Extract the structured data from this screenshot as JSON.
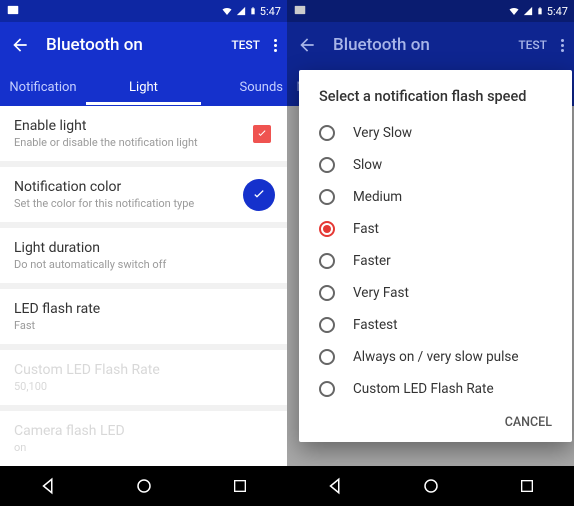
{
  "statusbar": {
    "time": "5:47"
  },
  "appbar": {
    "title": "Bluetooth on",
    "test": "TEST"
  },
  "tabs": {
    "t1": "Notification",
    "t2": "Light",
    "t3": "Sounds"
  },
  "rows": {
    "enable": {
      "name": "Enable light",
      "sub": "Enable or disable the notification light"
    },
    "color": {
      "name": "Notification color",
      "sub": "Set the color for this notification type"
    },
    "dur": {
      "name": "Light duration",
      "sub": "Do not automatically switch off"
    },
    "rate": {
      "name": "LED flash rate",
      "sub": "Fast"
    },
    "custom": {
      "name": "Custom LED Flash Rate",
      "sub": "50,100"
    },
    "camera": {
      "name": "Camera flash LED",
      "sub": "on"
    }
  },
  "dialog": {
    "title": "Select a notification flash speed",
    "opts": [
      "Very Slow",
      "Slow",
      "Medium",
      "Fast",
      "Faster",
      "Very Fast",
      "Fastest",
      "Always on / very slow pulse",
      "Custom LED Flash Rate"
    ],
    "selected": 3,
    "cancel": "CANCEL"
  }
}
